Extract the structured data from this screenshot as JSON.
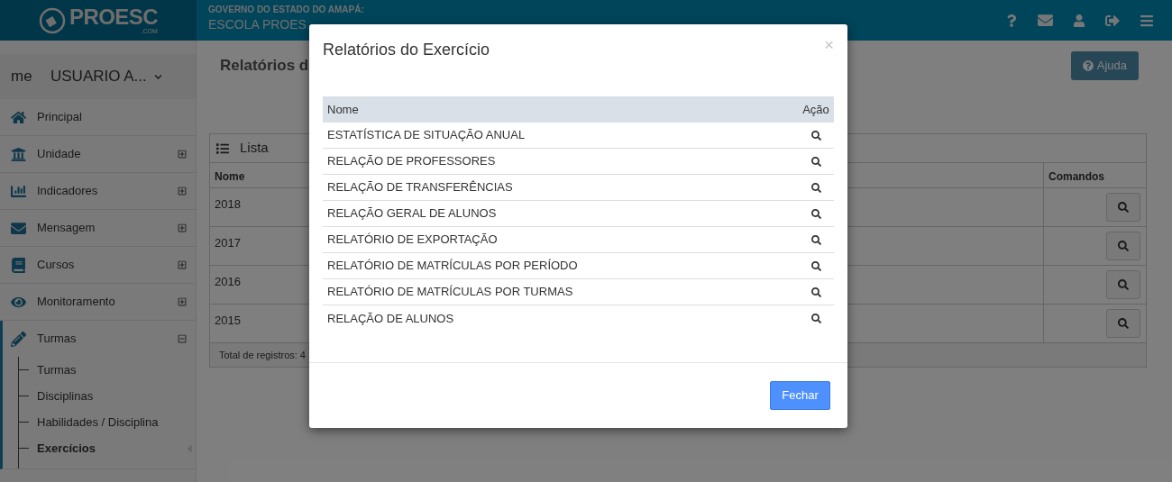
{
  "header": {
    "logo": "PROESC",
    "logo_sub": ".COM",
    "state": "GOVERNO DO ESTADO DO AMAPÁ:",
    "school": "ESCOLA PROES"
  },
  "user": {
    "avatar_alt": "me",
    "name": "USUARIO A..."
  },
  "sidebar": {
    "items": [
      {
        "label": "Principal",
        "expandable": false,
        "expanded": false
      },
      {
        "label": "Unidade",
        "expandable": true,
        "expanded": false
      },
      {
        "label": "Indicadores",
        "expandable": true,
        "expanded": false
      },
      {
        "label": "Mensagem",
        "expandable": true,
        "expanded": false
      },
      {
        "label": "Cursos",
        "expandable": true,
        "expanded": false
      },
      {
        "label": "Monitoramento",
        "expandable": true,
        "expanded": false
      },
      {
        "label": "Turmas",
        "expandable": true,
        "expanded": true,
        "children": [
          {
            "label": "Turmas",
            "selected": false
          },
          {
            "label": "Disciplinas",
            "selected": false
          },
          {
            "label": "Habilidades / Disciplina",
            "selected": false
          },
          {
            "label": "Exercícios",
            "selected": true
          }
        ]
      }
    ]
  },
  "page": {
    "title": "Relatórios d",
    "help_button": "Ajuda",
    "panel": {
      "title": "Lista",
      "columns": [
        "Nome",
        "Comandos"
      ],
      "rows": [
        "2018",
        "2017",
        "2016",
        "2015"
      ],
      "footer": "Total de registros: 4"
    }
  },
  "modal": {
    "title": "Relatórios do Exercício",
    "close": "×",
    "columns": [
      "Nome",
      "Ação"
    ],
    "rows": [
      "ESTATÍSTICA DE SITUAÇÃO ANUAL",
      "RELAÇÃO DE PROFESSORES",
      "RELAÇÃO DE TRANSFERÊNCIAS",
      "RELAÇÃO GERAL DE ALUNOS",
      "RELATÓRIO DE EXPORTAÇÃO",
      "RELATÓRIO DE MATRÍCULAS POR PERÍODO",
      "RELATÓRIO DE MATRÍCULAS POR TURMAS",
      "RELAÇÃO DE ALUNOS"
    ],
    "button": "Fechar"
  }
}
